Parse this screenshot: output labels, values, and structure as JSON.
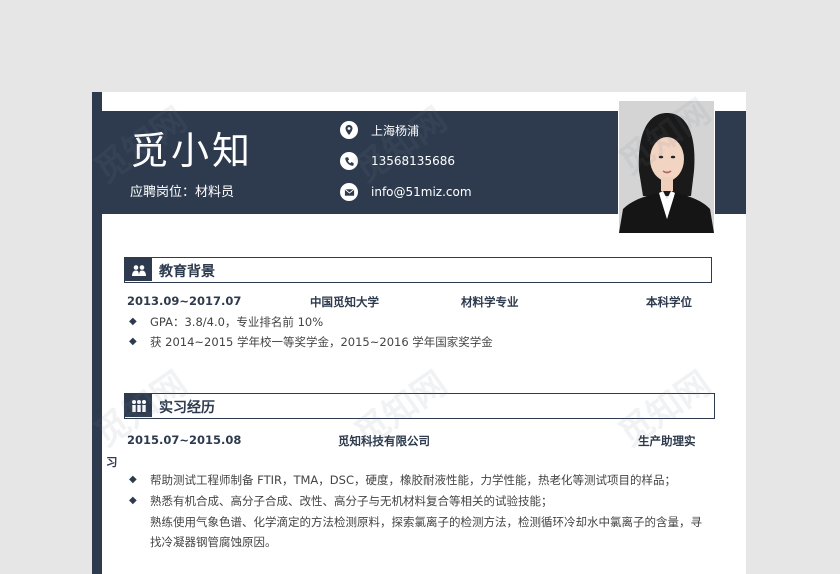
{
  "header": {
    "name": "觅小知",
    "position": "应聘岗位：材料员",
    "contacts": [
      {
        "icon": "location-pin-icon",
        "text": "上海杨浦"
      },
      {
        "icon": "phone-icon",
        "text": "13568135686"
      },
      {
        "icon": "email-icon",
        "text": "info@51miz.com"
      }
    ]
  },
  "education": {
    "title": "教育背景",
    "date": "2013.09~2017.07",
    "school": "中国觅知大学",
    "major": "材料学专业",
    "degree": "本科学位",
    "bullets": [
      "GPA：3.8/4.0，专业排名前 10%",
      "获 2014~2015 学年校一等奖学金，2015~2016 学年国家奖学金"
    ]
  },
  "internship": {
    "title": "实习经历",
    "date": "2015.07~2015.08",
    "company": "觅知科技有限公司",
    "role_line1": "生产助理实",
    "role_line2": "习",
    "bullets": [
      "帮助测试工程师制备 FTIR，TMA，DSC，硬度，橡胶耐液性能，力学性能，热老化等测试项目的样品；",
      "熟悉有机合成、高分子合成、改性、高分子与无机材料复合等相关的试验技能；"
    ],
    "continuation": [
      "熟练使用气象色谱、化学滴定的方法检测原料，探索氯离子的检测方法，检测循环冷却水中氯离子的含量，寻",
      "找冷凝器钢管腐蚀原因。"
    ]
  },
  "watermark": "觅知网",
  "colors": {
    "primary": "#2e3b4e",
    "background": "#e6e6e6"
  }
}
